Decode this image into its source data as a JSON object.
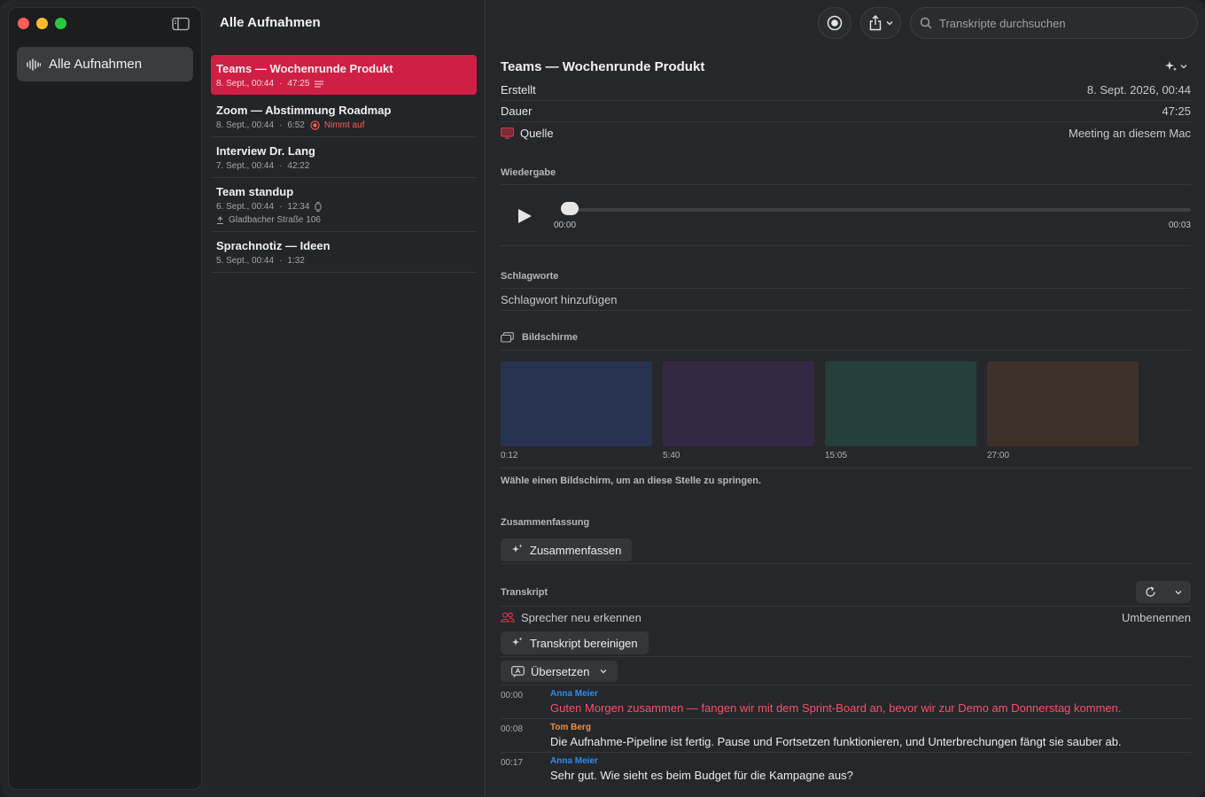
{
  "colors": {
    "accent": "#d01f45",
    "recording": "#ff5b52",
    "speaker_blue": "#2f8cf0",
    "speaker_orange": "#f0913a",
    "highlight_text": "#ff4d6d"
  },
  "sidebar": {
    "item_label": "Alle Aufnahmen"
  },
  "list": {
    "title": "Alle Aufnahmen",
    "recordings": [
      {
        "title": "Teams — Wochenrunde Produkt",
        "date": "8. Sept., 00:44",
        "duration": "47:25"
      },
      {
        "title": "Zoom — Abstimmung Roadmap",
        "date": "8. Sept., 00:44",
        "duration": "6:52",
        "status": "Nimmt auf"
      },
      {
        "title": "Interview Dr. Lang",
        "date": "7. Sept., 00:44",
        "duration": "42:22"
      },
      {
        "title": "Team standup",
        "date": "6. Sept., 00:44",
        "duration": "12:34",
        "location": "Gladbacher Straße 106"
      },
      {
        "title": "Sprachnotiz — Ideen",
        "date": "5. Sept., 00:44",
        "duration": "1:32"
      }
    ],
    "sep": "·"
  },
  "search": {
    "placeholder": "Transkripte durchsuchen"
  },
  "detail": {
    "title": "Teams — Wochenrunde Produkt",
    "created_label": "Erstellt",
    "created_value": "8. Sept. 2026, 00:44",
    "duration_label": "Dauer",
    "duration_value": "47:25",
    "source_label": "Quelle",
    "source_value": "Meeting an diesem Mac",
    "playback_label": "Wiedergabe",
    "playback_start": "00:00",
    "playback_end": "00:03",
    "playback_progress": 0.0,
    "tags_label": "Schlagworte",
    "tags_placeholder": "Schlagwort hinzufügen",
    "screens_label": "Bildschirme",
    "screens": [
      {
        "time": "0:12",
        "color": "#283352"
      },
      {
        "time": "5:40",
        "color": "#352845"
      },
      {
        "time": "15:05",
        "color": "#243f3c"
      },
      {
        "time": "27:00",
        "color": "#3e3128"
      }
    ],
    "screens_hint": "Wähle einen Bildschirm, um an diese Stelle zu springen.",
    "summary_label": "Zusammenfassung",
    "summarize_button": "Zusammenfassen",
    "transcript_label": "Transkript",
    "recognize_speakers": "Sprecher neu erkennen",
    "rename": "Umbenennen",
    "clean_button": "Transkript bereinigen",
    "translate_button": "Übersetzen",
    "transcript": [
      {
        "time": "00:00",
        "speaker": "Anna Meier",
        "text": "Guten Morgen zusammen — fangen wir mit dem Sprint-Board an, bevor wir zur Demo am Donnerstag kommen."
      },
      {
        "time": "00:08",
        "speaker": "Tom Berg",
        "text": "Die Aufnahme-Pipeline ist fertig. Pause und Fortsetzen funktionieren, und Unterbrechungen fängt sie sauber ab."
      },
      {
        "time": "00:17",
        "speaker": "Anna Meier",
        "text": "Sehr gut. Wie sieht es beim Budget für die Kampagne aus?"
      }
    ]
  }
}
